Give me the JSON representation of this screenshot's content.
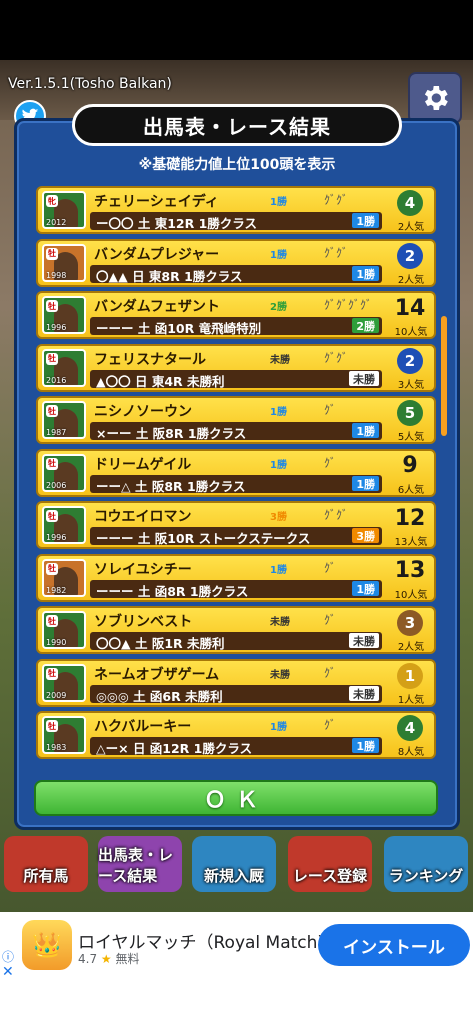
{
  "app": {
    "version": "Ver.1.5.1(Tosho Balkan)"
  },
  "dialog": {
    "title": "出馬表・レース結果",
    "subtitle": "※基礎能力値上位100頭を表示",
    "ok_label": "ＯＫ"
  },
  "horses": [
    {
      "name": "チェリーシェイディ",
      "sex": "牝",
      "year": "2012",
      "portrait": "green",
      "wins_top": "1勝",
      "wins_top_color": "#1e88e5",
      "medals": "ｸﾞｸﾞ",
      "info": "ー〇〇 土 東12R 1勝クラス",
      "wins_badge": "1勝",
      "wins_badge_bg": "#1e88e5",
      "place": "4",
      "place_style": "wreath-green",
      "popularity": "2人気"
    },
    {
      "name": "バンダムプレジャー",
      "sex": "牡",
      "year": "1998",
      "portrait": "orange",
      "wins_top": "1勝",
      "wins_top_color": "#1e88e5",
      "medals": "ｸﾞｸﾞ",
      "info": "〇▲▲ 日 東8R 1勝クラス",
      "wins_badge": "1勝",
      "wins_badge_bg": "#1e88e5",
      "place": "2",
      "place_style": "medal-blue",
      "popularity": "2人気"
    },
    {
      "name": "バンダムフェザント",
      "sex": "牡",
      "year": "1996",
      "portrait": "green",
      "wins_top": "2勝",
      "wins_top_color": "#2e9e3a",
      "medals": "ｸﾞｸﾞｸﾞｸﾞ",
      "info": "ーーー 土 函10R 竜飛崎特別",
      "wins_badge": "2勝",
      "wins_badge_bg": "#2e9e3a",
      "place": "14",
      "place_style": "plain",
      "popularity": "10人気"
    },
    {
      "name": "フェリスナタール",
      "sex": "牡",
      "year": "2016",
      "portrait": "green",
      "wins_top": "未勝",
      "wins_top_color": "#333333",
      "medals": "ｸﾞｸﾞ",
      "info": "▲〇〇 日 東4R 未勝利",
      "wins_badge": "未勝",
      "wins_badge_bg": "#ffffff",
      "place": "2",
      "place_style": "medal-blue",
      "popularity": "3人気"
    },
    {
      "name": "ニシノソーウン",
      "sex": "牡",
      "year": "1987",
      "portrait": "green",
      "wins_top": "1勝",
      "wins_top_color": "#1e88e5",
      "medals": "ｸﾞ",
      "info": "×ーー 土 阪8R 1勝クラス",
      "wins_badge": "1勝",
      "wins_badge_bg": "#1e88e5",
      "place": "5",
      "place_style": "wreath-green",
      "popularity": "5人気"
    },
    {
      "name": "ドリームゲイル",
      "sex": "牡",
      "year": "2006",
      "portrait": "green",
      "wins_top": "1勝",
      "wins_top_color": "#1e88e5",
      "medals": "ｸﾞ",
      "info": "ーー△ 土 阪8R 1勝クラス",
      "wins_badge": "1勝",
      "wins_badge_bg": "#1e88e5",
      "place": "9",
      "place_style": "plain",
      "popularity": "6人気"
    },
    {
      "name": "コウエイロマン",
      "sex": "牡",
      "year": "1996",
      "portrait": "green",
      "wins_top": "3勝",
      "wins_top_color": "#f08a00",
      "medals": "ｸﾞｸﾞ",
      "info": "ーーー 土 阪10R ストークステークス",
      "wins_badge": "3勝",
      "wins_badge_bg": "#f08a00",
      "place": "12",
      "place_style": "plain",
      "popularity": "13人気"
    },
    {
      "name": "ソレイユシチー",
      "sex": "牡",
      "year": "1982",
      "portrait": "orange",
      "wins_top": "1勝",
      "wins_top_color": "#1e88e5",
      "medals": "ｸﾞ",
      "info": "ーーー 土 函8R 1勝クラス",
      "wins_badge": "1勝",
      "wins_badge_bg": "#1e88e5",
      "place": "13",
      "place_style": "plain",
      "popularity": "10人気"
    },
    {
      "name": "ソブリンベスト",
      "sex": "牡",
      "year": "1990",
      "portrait": "green",
      "wins_top": "未勝",
      "wins_top_color": "#333333",
      "medals": "ｸﾞ",
      "info": "〇〇▲ 土 阪1R 未勝利",
      "wins_badge": "未勝",
      "wins_badge_bg": "#ffffff",
      "place": "3",
      "place_style": "medal-bronze",
      "popularity": "2人気"
    },
    {
      "name": "ネームオブザゲーム",
      "sex": "牡",
      "year": "2009",
      "portrait": "green",
      "wins_top": "未勝",
      "wins_top_color": "#333333",
      "medals": "ｸﾞ",
      "info": "◎◎◎ 土 函6R 未勝利",
      "wins_badge": "未勝",
      "wins_badge_bg": "#ffffff",
      "place": "1",
      "place_style": "trophy",
      "popularity": "1人気"
    },
    {
      "name": "ハクバルーキー",
      "sex": "牡",
      "year": "1983",
      "portrait": "green",
      "wins_top": "1勝",
      "wins_top_color": "#1e88e5",
      "medals": "ｸﾞ",
      "info": "△ー× 日 函12R 1勝クラス",
      "wins_badge": "1勝",
      "wins_badge_bg": "#1e88e5",
      "place": "4",
      "place_style": "wreath-green",
      "popularity": "8人気"
    }
  ],
  "nav": [
    {
      "label": "所有馬",
      "color": "#c0392b"
    },
    {
      "label": "出馬表・レース結果",
      "color": "#8e44ad"
    },
    {
      "label": "新規入厩",
      "color": "#2e86c1"
    },
    {
      "label": "レース登録",
      "color": "#c0392b"
    },
    {
      "label": "ランキング",
      "color": "#2e86c1"
    }
  ],
  "ad": {
    "title": "ロイヤルマッチ（Royal Match)",
    "rating": "4.7",
    "price": "無料",
    "install_label": "インストール"
  }
}
